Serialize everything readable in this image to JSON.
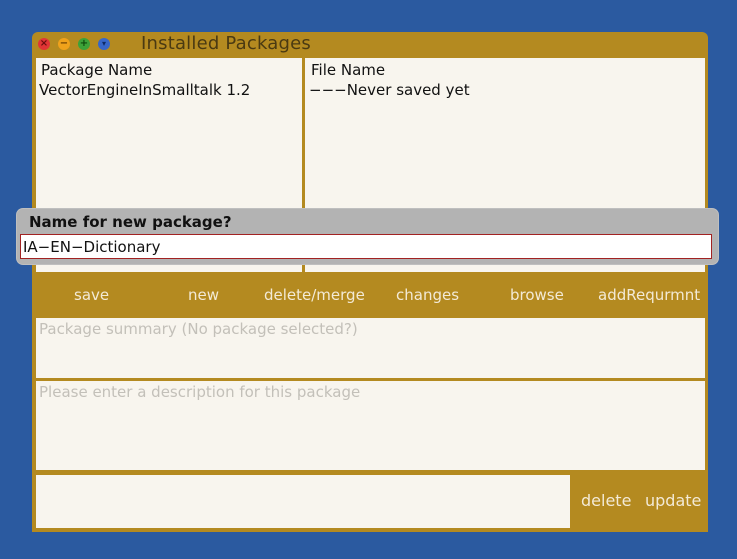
{
  "window": {
    "title": "Installed Packages"
  },
  "titlebar_icons": {
    "close": "×",
    "minimize": "−",
    "maximize": "+",
    "menu": "▾"
  },
  "packages_pane": {
    "header": "Package Name",
    "items": [
      "VectorEngineInSmalltalk 1.2"
    ]
  },
  "files_pane": {
    "header": "File Name",
    "items": [
      "−−−Never saved yet"
    ]
  },
  "toolbar": {
    "buttons": [
      "save",
      "new",
      "delete/merge",
      "changes",
      "browse",
      "addRequrmnt"
    ]
  },
  "summary": {
    "placeholder": "Package summary (No package selected?)"
  },
  "description": {
    "placeholder": "Please enter a description for this package"
  },
  "bottom": {
    "delete_label": "delete",
    "update_label": "update"
  },
  "dialog": {
    "label": "Name for new package?",
    "value": "IA−EN−Dictionary"
  },
  "colors": {
    "desktop": "#2b5aa0",
    "window": "#b48a20",
    "pane": "#f8f5ee",
    "dialog": "#b3b3b3",
    "input_border": "#a22222"
  }
}
